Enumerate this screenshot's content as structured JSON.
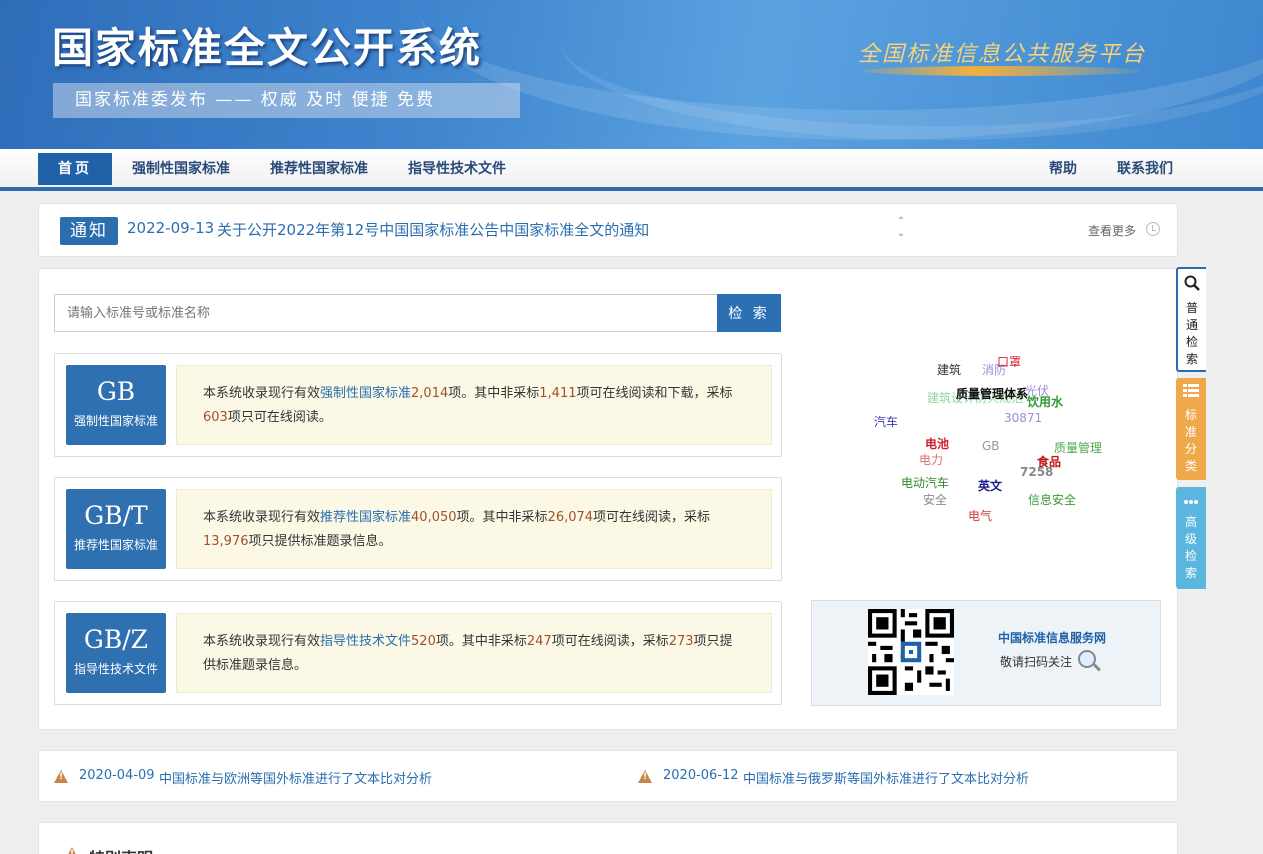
{
  "header": {
    "title": "国家标准全文公开系统",
    "slogan": "国家标准委发布 —— 权威 及时 便捷 免费",
    "platform": "全国标准信息公共服务平台"
  },
  "nav": {
    "home": "首页",
    "items": [
      "强制性国家标准",
      "推荐性国家标准",
      "指导性技术文件"
    ],
    "help": "帮助",
    "contact": "联系我们"
  },
  "notice": {
    "badge": "通知",
    "date": "2022-09-13",
    "text": "关于公开2022年第12号中国国家标准公告中国家标准全文的通知",
    "more": "查看更多"
  },
  "search": {
    "placeholder": "请输入标准号或标准名称",
    "button": "检 索"
  },
  "standards": [
    {
      "code": "GB",
      "name": "强制性国家标准",
      "p1": "本系统收录现行有效",
      "type": "强制性国家标准",
      "total": "2,014",
      "p2": "项。其中非采标",
      "nonadopt": "1,411",
      "p3": "项可在线阅读和下载，采标",
      "adopt": "603",
      "p4": "项只可在线阅读。"
    },
    {
      "code": "GB/T",
      "name": "推荐性国家标准",
      "p1": "本系统收录现行有效",
      "type": "推荐性国家标准",
      "total": "40,050",
      "p2": "项。其中非采标",
      "nonadopt": "26,074",
      "p3": "项可在线阅读，采标",
      "adopt": "13,976",
      "p4": "项只提供标准题录信息。"
    },
    {
      "code": "GB/Z",
      "name": "指导性技术文件",
      "p1": "本系统收录现行有效",
      "type": "指导性技术文件",
      "total": "520",
      "p2": "项。其中非采标",
      "nonadopt": "247",
      "p3": "项可在线阅读，采标",
      "adopt": "273",
      "p4": "项只提供标准题录信息。"
    }
  ],
  "tag_cloud": [
    {
      "text": "建筑",
      "color": "#333333"
    },
    {
      "text": "消防",
      "color": "#9b8fd6"
    },
    {
      "text": "口罩",
      "color": "#d0202a"
    },
    {
      "text": "质量管理体系",
      "color": "#111111"
    },
    {
      "text": "光伏",
      "color": "#9b8fd6"
    },
    {
      "text": "建筑设计防火规范",
      "color": "#8fd6a0"
    },
    {
      "text": "饮用水",
      "color": "#2e9a2e"
    },
    {
      "text": "30871",
      "color": "#9b8fd6"
    },
    {
      "text": "汽车",
      "color": "#3a3ab0"
    },
    {
      "text": "电池",
      "color": "#d0202a"
    },
    {
      "text": "GB",
      "color": "#999999"
    },
    {
      "text": "质量管理",
      "color": "#4fa84f"
    },
    {
      "text": "电力",
      "color": "#e07070"
    },
    {
      "text": "食品",
      "color": "#c01818"
    },
    {
      "text": "7258",
      "color": "#888888"
    },
    {
      "text": "电动汽车",
      "color": "#2e8a2e"
    },
    {
      "text": "英文",
      "color": "#1a1a8a"
    },
    {
      "text": "安全",
      "color": "#888888"
    },
    {
      "text": "信息安全",
      "color": "#3a9a3a"
    },
    {
      "text": "电气",
      "color": "#d03a3a"
    }
  ],
  "qr": {
    "title": "中国标准信息服务网",
    "subtitle": "敬请扫码关注"
  },
  "side_tabs": [
    {
      "label": "普通检索",
      "icon": "search-icon"
    },
    {
      "label": "标准分类",
      "icon": "list-icon"
    },
    {
      "label": "高级检索",
      "icon": "more-icon"
    }
  ],
  "news": [
    {
      "date": "2020-04-09",
      "text": "中国标准与欧洲等国外标准进行了文本比对分析"
    },
    {
      "date": "2020-06-12",
      "text": "中国标准与俄罗斯等国外标准进行了文本比对分析"
    }
  ],
  "statement": {
    "title": "特别声明"
  }
}
